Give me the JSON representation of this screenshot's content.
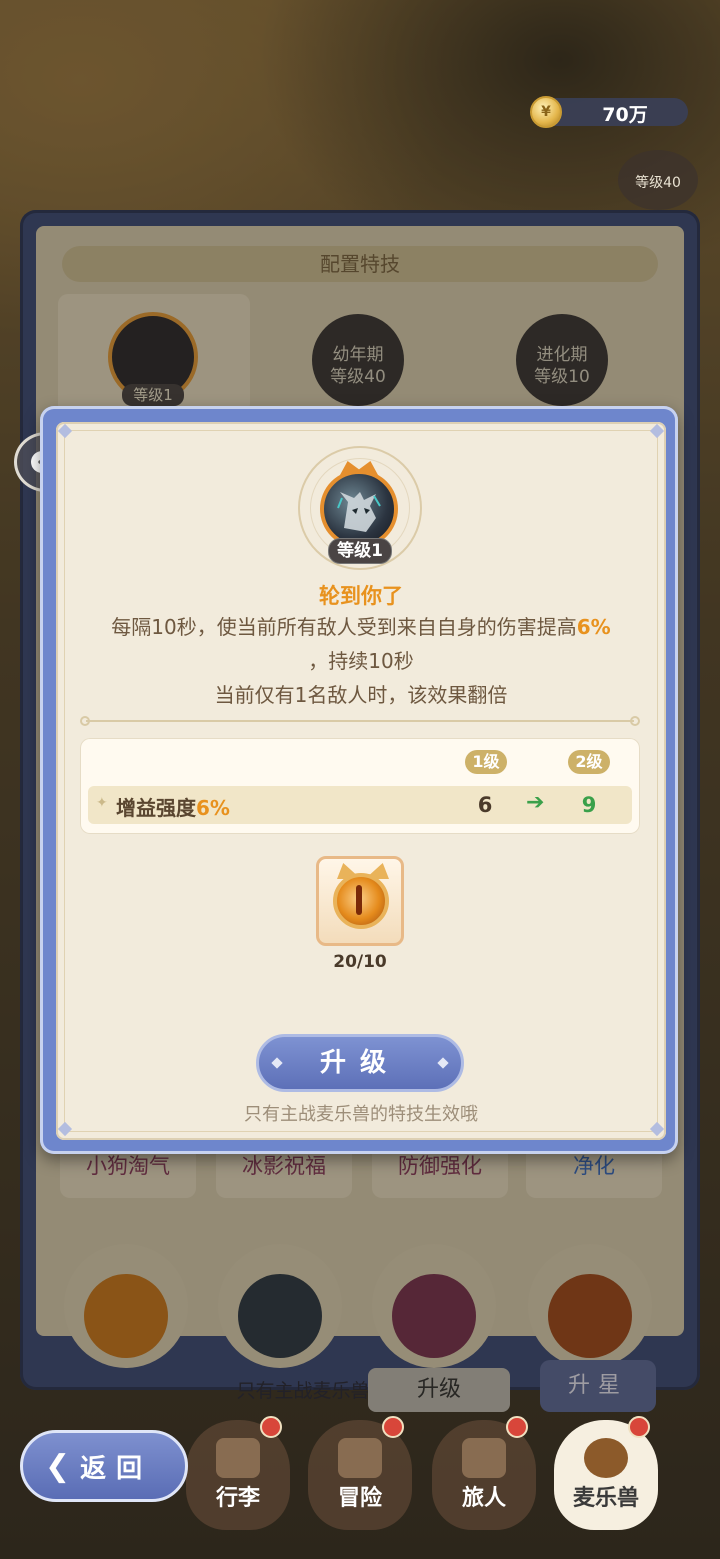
{
  "currency": {
    "icon": "coin-icon",
    "amount": "70万"
  },
  "background": {
    "level40_badge": "等级40",
    "panel_title": "配置特技",
    "slots": [
      {
        "level": "等级1"
      },
      {
        "stage": "幼年期",
        "level": "等级40"
      },
      {
        "stage": "进化期",
        "level": "等级10"
      }
    ],
    "skills": [
      "小狗淘气",
      "冰影祝福",
      "防御强化",
      "净化"
    ],
    "bottom_hint": "只有主战麦乐兽的特技生效哦",
    "upgrade_label": "升级",
    "star_label": "升星"
  },
  "dialog": {
    "level_tag": "等级1",
    "skill_name": "轮到你了",
    "desc_line1_a": "每隔10秒，使当前所有敌人受到来自自身的伤害提高",
    "desc_line1_b": "6%",
    "desc_line2": "，持续10秒",
    "desc_line3": "当前仅有1名敌人时，该效果翻倍",
    "table": {
      "col_current": "1级",
      "col_next": "2级",
      "row_label_a": "增益强度",
      "row_label_b": "6%",
      "value_current": "6",
      "value_next": "9"
    },
    "item": {
      "name": "skill-material",
      "count": "20/10"
    },
    "upgrade_button": "升级",
    "hint": "只有主战麦乐兽的特技生效哦"
  },
  "nav": {
    "back_label": "返回",
    "items": [
      {
        "label": "行李",
        "dot": true
      },
      {
        "label": "冒险",
        "dot": true
      },
      {
        "label": "旅人",
        "dot": true
      },
      {
        "label": "麦乐兽",
        "dot": true,
        "active": true
      }
    ]
  },
  "colors": {
    "accent": "#e8921e",
    "button_blue": "#6e86cc",
    "up_green": "#3aa04a"
  }
}
